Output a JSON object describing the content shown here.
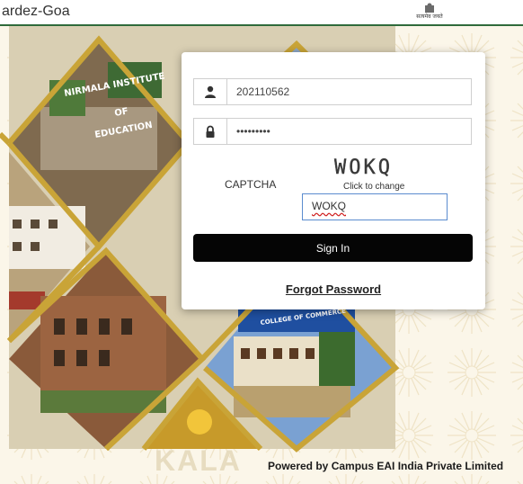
{
  "header": {
    "title": "ardez-Goa",
    "emblem_caption": "सत्यमेव जयते"
  },
  "login": {
    "username_value": "202110562",
    "password_value": "•••••••••",
    "captcha_label": "CAPTCHA",
    "captcha_text": "WOKQ",
    "captcha_change": "Click to change",
    "captcha_input_value": "WOKQ",
    "signin_label": "Sign In",
    "forgot_label": "Forgot Password"
  },
  "background": {
    "building_sign_1": "NIRMALA INSTITUTE OF EDUCATION",
    "building_sign_1_lines": [
      "NIRMALA INSTITUTE",
      "OF",
      "EDUCATION"
    ],
    "building_sign_2": "COLLEGE OF COMMERCE",
    "kala_text": "KALA"
  },
  "footer": {
    "powered_by": "Powered by Campus EAI India Private Limited"
  },
  "colors": {
    "header_rule": "#2f6b3b",
    "signin_bg": "#050505",
    "captcha_border": "#5b8ccf",
    "collage_gold": "#c9a437"
  },
  "icons": {
    "username": "user-icon",
    "password": "lock-icon"
  }
}
